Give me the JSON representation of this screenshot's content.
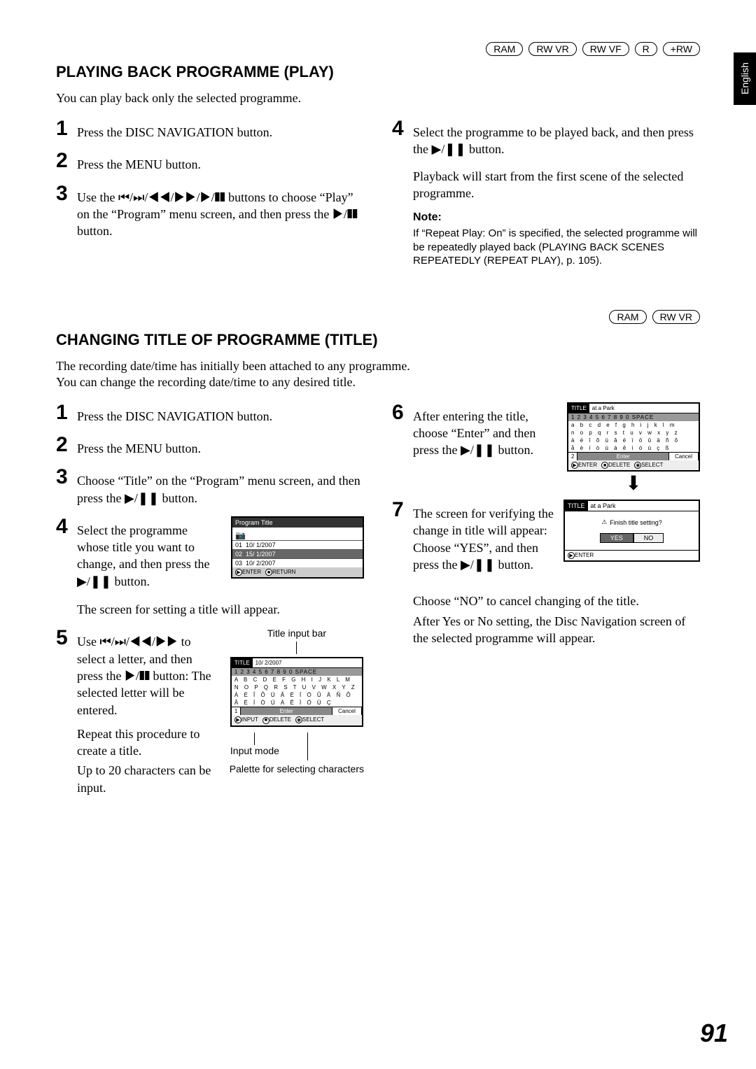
{
  "side_tab": "English",
  "badges_top": [
    "RAM",
    "RW VR",
    "RW VF",
    "R",
    "+RW"
  ],
  "section1": {
    "title": "PLAYING BACK PROGRAMME (PLAY)",
    "intro": "You can play back only the selected programme.",
    "steps_left": [
      "Press the DISC NAVIGATION button.",
      "Press the MENU button.",
      "Use the ⏮/⏭/◀◀/▶▶/▶/❚❚ buttons to choose “Play” on the “Program” menu screen, and then press the ▶/❚❚ button."
    ],
    "step4": "Select the programme to be played back, and then press the ▶/❚❚ button.",
    "step4_after": "Playback will start from the first scene of the selected programme.",
    "note_head": "Note:",
    "note_text": "If “Repeat Play: On” is specified, the selected programme will be repeatedly played back (PLAYING BACK SCENES REPEATEDLY (REPEAT PLAY), p. 105)."
  },
  "badges_mid": [
    "RAM",
    "RW VR"
  ],
  "section2": {
    "title": "CHANGING TITLE OF PROGRAMME (TITLE)",
    "intro1": "The recording date/time has initially been attached to any programme.",
    "intro2": "You can change the recording date/time to any desired title.",
    "steps_left_simple": [
      "Press the DISC NAVIGATION button.",
      "Press the MENU button.",
      "Choose “Title” on the “Program” menu screen, and then press the ▶/❚❚ button."
    ],
    "step4_text": "Select the programme whose title you want to change, and then press the ▶/❚❚ button.",
    "step4_after": "The screen for setting a title will appear.",
    "step5_text": "Use ⏮/⏭/◀◀/▶▶ to select a letter, and then press the ▶/❚❚ button: The selected letter will be entered.",
    "step5_after1": "Repeat this procedure to create a title.",
    "step5_after2": "Up to 20 characters can be input.",
    "title_input_label": "Title input bar",
    "input_mode_label": "Input mode",
    "palette_label": "Palette for selecting characters",
    "step6_text": "After entering the title, choose “Enter” and then press the ▶/❚❚ button.",
    "step7_text": "The screen for verifying the change in title will appear: Choose “YES”, and then press the ▶/❚❚ button.",
    "step7_after1": "Choose “NO” to cancel changing of the title.",
    "step7_after2": "After Yes or No setting, the Disc Navigation screen of the selected programme will appear.",
    "program_title_screen": {
      "header": "Program Title",
      "rows": [
        {
          "id": "01",
          "date": "10/ 1/2007"
        },
        {
          "id": "02",
          "date": "15/ 1/2007"
        },
        {
          "id": "03",
          "date": "10/ 2/2007"
        }
      ],
      "footer": [
        "ENTER",
        "RETURN"
      ]
    },
    "palette_screen": {
      "label": "TITLE",
      "header_text": "10/ 2/2007",
      "rows_upper": [
        "1 2 3 4 5 6 7 8 9 0 SPACE",
        "A B C D E F G H I J K L M",
        "N O P Q R S T U V W X Y Z",
        "À É Î Õ Ü Â Ë Ï Ö Û Ä Ñ Ô",
        "Å È Í Ò Ú Á Ê Ì Ó Ù Ç"
      ],
      "mode": "1",
      "enter": "Enter",
      "cancel": "Cancel",
      "footer": [
        "INPUT",
        "DELETE",
        "SELECT"
      ]
    },
    "palette_screen_lower": {
      "label": "TITLE",
      "header_text": "at a Park",
      "rows_lower": [
        "1 2 3 4 5 6 7 8 9 0 SPACE",
        "a b c d e f g h i j k l m",
        "n o p q r s t u v w x y z",
        "à é î õ ü â ë ï ö û ä ñ ô",
        "å è í ò ú á ê ì ó ù ç ß"
      ],
      "mode": "2",
      "enter": "Enter",
      "cancel": "Cancel",
      "footer": [
        "ENTER",
        "DELETE",
        "SELECT"
      ]
    },
    "verify_screen": {
      "label": "TITLE",
      "header_text": "at a Park",
      "question": "Finish title setting?",
      "yes": "YES",
      "no": "NO",
      "footer": "ENTER"
    }
  },
  "page_number": "91"
}
